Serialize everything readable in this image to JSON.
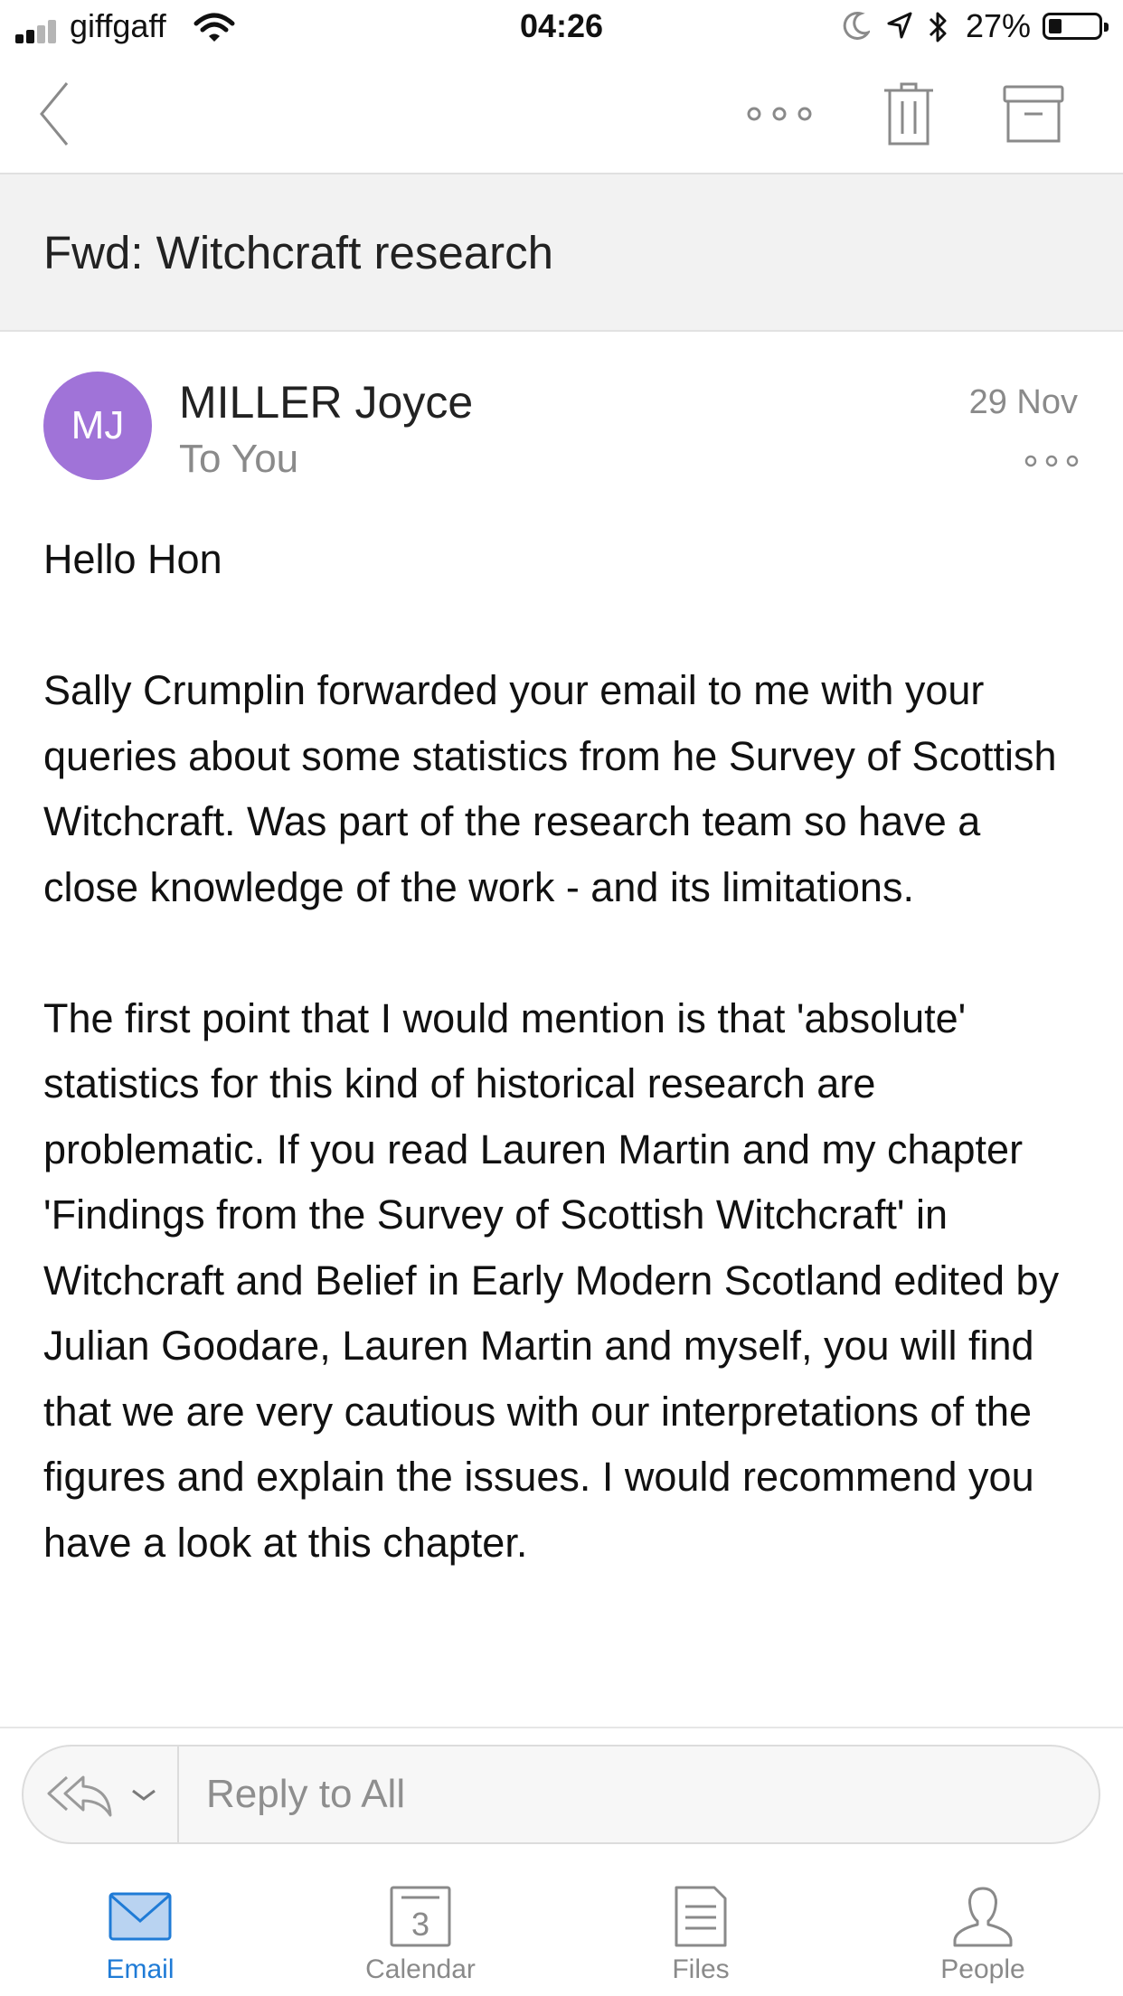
{
  "status_bar": {
    "carrier": "giffgaff",
    "time": "04:26",
    "battery_percent": "27%",
    "battery_level": 0.27
  },
  "nav": {
    "back_icon": "chevron-left-icon",
    "more_icon": "more-horizontal-icon",
    "delete_icon": "trash-icon",
    "archive_icon": "archive-icon"
  },
  "email": {
    "subject": "Fwd: Witchcraft research",
    "sender": {
      "initials": "MJ",
      "name": "MILLER Joyce",
      "recipient_line": "To You",
      "date": "29 Nov",
      "avatar_color": "#a073d8"
    },
    "body": {
      "greeting": "Hello Hon",
      "paragraph_1": "Sally Crumplin forwarded your email to me with your queries about some statistics from he Survey of Scottish Witchcraft. Was part of the research team so have a close knowledge of the work - and its limitations.",
      "paragraph_2": "The first point that I would mention is that 'absolute' statistics for this kind of historical research are problematic. If you read Lauren Martin and my chapter 'Findings from the Survey of Scottish Witchcraft' in Witchcraft and Belief in Early Modern Scotland edited by Julian Goodare, Lauren Martin and myself, you will find that we are very cautious with our interpretations of the figures and explain the issues. I would recommend you have a look at this chapter."
    }
  },
  "reply": {
    "placeholder": "Reply to All"
  },
  "tabs": [
    {
      "label": "Email",
      "active": true,
      "icon": "mail-icon"
    },
    {
      "label": "Calendar",
      "active": false,
      "icon": "calendar-icon",
      "day": "3"
    },
    {
      "label": "Files",
      "active": false,
      "icon": "file-icon"
    },
    {
      "label": "People",
      "active": false,
      "icon": "person-icon"
    }
  ],
  "colors": {
    "accent": "#1f7bd6",
    "subject_bg": "#f2f2f2",
    "secondary_text": "#8a8a8a"
  }
}
